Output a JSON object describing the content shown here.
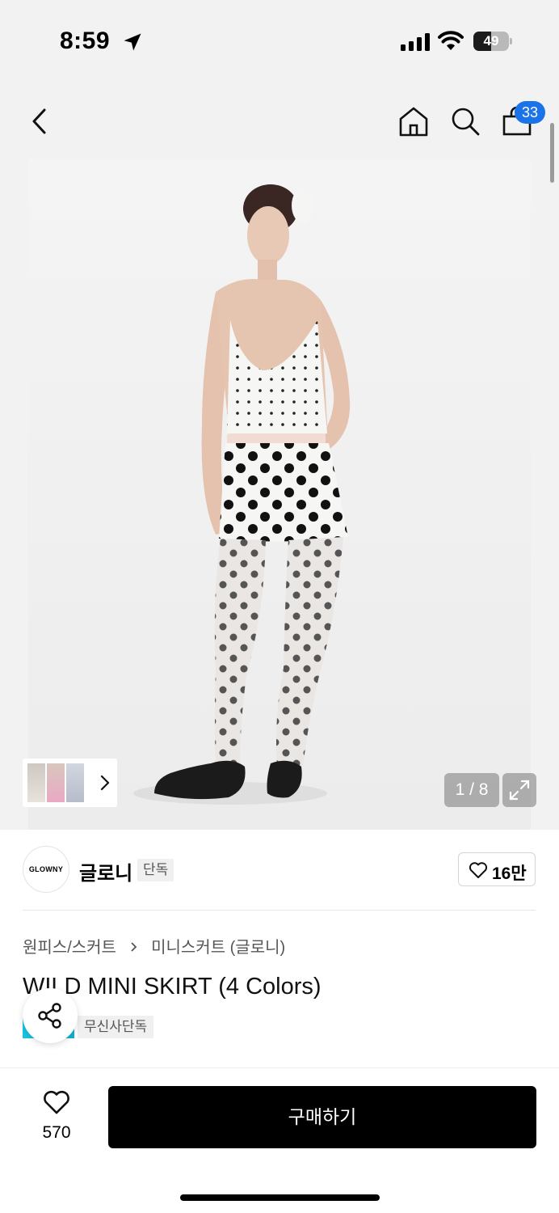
{
  "status_bar": {
    "time": "8:59",
    "battery_level": "49",
    "battery_fraction": 0.49
  },
  "nav": {
    "cart_count": "33"
  },
  "gallery": {
    "page_counter": "1 / 8",
    "current_page": 1,
    "total_pages": 8
  },
  "brand": {
    "logo_text": "GLOWNY",
    "name": "글로니",
    "tag": "단독",
    "likes": "16만"
  },
  "breadcrumb": {
    "category": "원피스/스커트",
    "subcategory": "미니스커트 (글로니)"
  },
  "product": {
    "title": "WILD MINI SKIRT (4 Colors)",
    "exclusive_tag": "무신사단독"
  },
  "bottom_bar": {
    "wish_count": "570",
    "buy_label": "구매하기"
  },
  "colors": {
    "accent_badge": "#1a73e8",
    "buy_button": "#000000",
    "exclusive_badge": "#18c6e0"
  },
  "icons": [
    "location-arrow-icon",
    "signal-icon",
    "wifi-icon",
    "battery-icon",
    "back-chevron-icon",
    "home-icon",
    "search-icon",
    "bag-icon",
    "chevron-right-icon",
    "expand-icon",
    "heart-icon",
    "share-icon"
  ]
}
